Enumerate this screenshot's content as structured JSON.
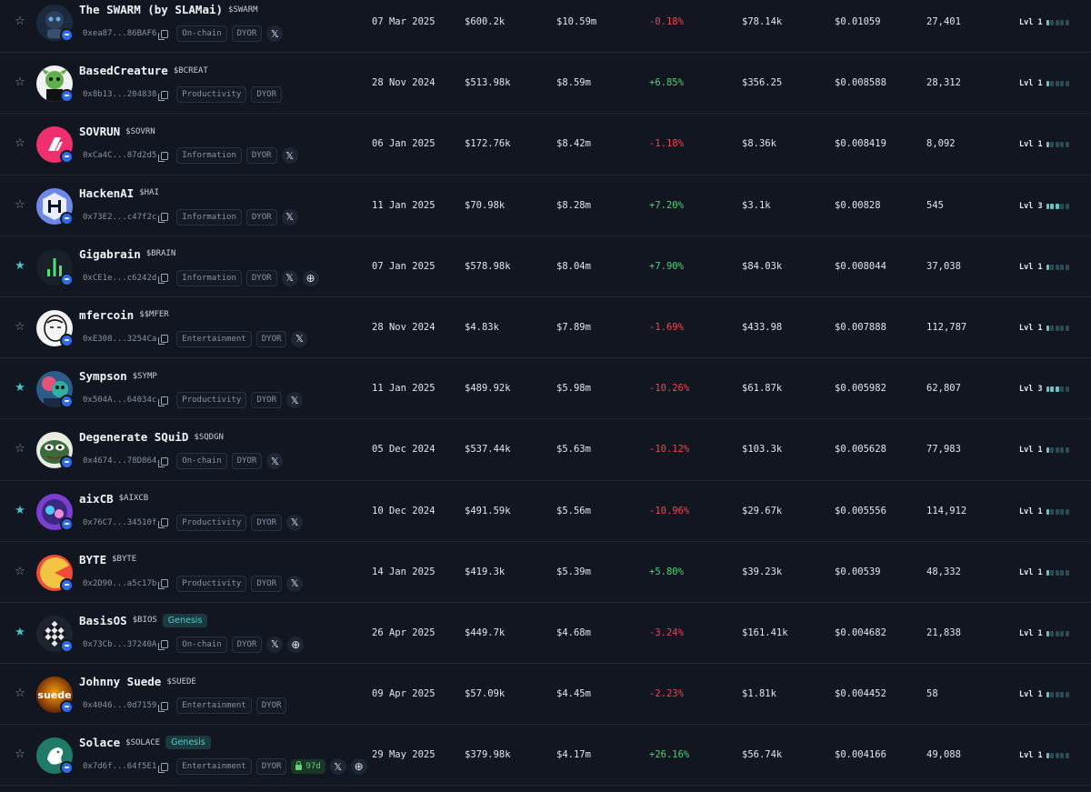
{
  "rows": [
    {
      "starred": false,
      "name": "The SWARM (by SLAMai)",
      "ticker": "$SWARM",
      "genesis": "",
      "address": "0xea87...86BAF6",
      "category": "On-chain",
      "dyor": "DYOR",
      "lock": "",
      "socials": [
        "x"
      ],
      "date": "07 Mar 2025",
      "liquidity": "$600.2k",
      "market_cap": "$10.59m",
      "change": "-0.18%",
      "change_dir": "neg",
      "volume": "$78.14k",
      "price": "$0.01059",
      "holders": "27,401",
      "level": "Lvl 1",
      "level_value": 1,
      "avatar_icon": "robot-avatar",
      "avatar_bg": "#1c2a3e",
      "avatar_fg": "#6aa6e8"
    },
    {
      "starred": false,
      "name": "BasedCreature",
      "ticker": "$BCREAT",
      "genesis": "",
      "address": "0x8b13...204838",
      "category": "Productivity",
      "dyor": "DYOR",
      "lock": "",
      "socials": [],
      "date": "28 Nov 2024",
      "liquidity": "$513.98k",
      "market_cap": "$8.59m",
      "change": "+6.85%",
      "change_dir": "pos",
      "volume": "$356.25",
      "price": "$0.008588",
      "holders": "28,312",
      "level": "Lvl 1",
      "level_value": 1,
      "avatar_icon": "creature-avatar",
      "avatar_bg": "#0b0d10",
      "avatar_fg": "#5fb04a"
    },
    {
      "starred": false,
      "name": "SOVRUN",
      "ticker": "$SOVRN",
      "genesis": "",
      "address": "0xCa4C...87d2d5",
      "category": "Information",
      "dyor": "DYOR",
      "lock": "",
      "socials": [
        "x"
      ],
      "date": "06 Jan 2025",
      "liquidity": "$172.76k",
      "market_cap": "$8.42m",
      "change": "-1.18%",
      "change_dir": "neg",
      "volume": "$8.36k",
      "price": "$0.008419",
      "holders": "8,092",
      "level": "Lvl 1",
      "level_value": 1,
      "avatar_icon": "sovrun-logo",
      "avatar_bg": "#f0306e",
      "avatar_fg": "#ffffff"
    },
    {
      "starred": false,
      "name": "HackenAI",
      "ticker": "$HAI",
      "genesis": "",
      "address": "0x73E2...c47f2c",
      "category": "Information",
      "dyor": "DYOR",
      "lock": "",
      "socials": [
        "x"
      ],
      "date": "11 Jan 2025",
      "liquidity": "$70.98k",
      "market_cap": "$8.28m",
      "change": "+7.20%",
      "change_dir": "pos",
      "volume": "$3.1k",
      "price": "$0.00828",
      "holders": "545",
      "level": "Lvl 3",
      "level_value": 3,
      "avatar_icon": "hacken-logo",
      "avatar_bg": "#6f88e8",
      "avatar_fg": "#0d1320"
    },
    {
      "starred": true,
      "name": "Gigabrain",
      "ticker": "$BRAIN",
      "genesis": "",
      "address": "0xCE1e...c6242d",
      "category": "Information",
      "dyor": "DYOR",
      "lock": "",
      "socials": [
        "x",
        "web"
      ],
      "date": "07 Jan 2025",
      "liquidity": "$578.98k",
      "market_cap": "$8.04m",
      "change": "+7.90%",
      "change_dir": "pos",
      "volume": "$84.03k",
      "price": "$0.008044",
      "holders": "37,038",
      "level": "Lvl 1",
      "level_value": 1,
      "avatar_icon": "gigabrain-logo",
      "avatar_bg": "#1a2028",
      "avatar_fg": "#4fe07a"
    },
    {
      "starred": false,
      "name": "mfercoin",
      "ticker": "$$MFER",
      "genesis": "",
      "address": "0xE308...3254Ca",
      "category": "Entertainment",
      "dyor": "DYOR",
      "lock": "",
      "socials": [
        "x"
      ],
      "date": "28 Nov 2024",
      "liquidity": "$4.83k",
      "market_cap": "$7.89m",
      "change": "-1.69%",
      "change_dir": "neg",
      "volume": "$433.98",
      "price": "$0.007888",
      "holders": "112,787",
      "level": "Lvl 1",
      "level_value": 1,
      "avatar_icon": "mfer-avatar",
      "avatar_bg": "#f4f4f4",
      "avatar_fg": "#111111"
    },
    {
      "starred": true,
      "name": "Sympson",
      "ticker": "$SYMP",
      "genesis": "",
      "address": "0x504A...64034c",
      "category": "Productivity",
      "dyor": "DYOR",
      "lock": "",
      "socials": [
        "x"
      ],
      "date": "11 Jan 2025",
      "liquidity": "$489.92k",
      "market_cap": "$5.98m",
      "change": "-10.26%",
      "change_dir": "neg",
      "volume": "$61.87k",
      "price": "$0.005982",
      "holders": "62,807",
      "level": "Lvl 3",
      "level_value": 3,
      "avatar_icon": "sympson-avatar",
      "avatar_bg": "#2c5d8a",
      "avatar_fg": "#e8527a"
    },
    {
      "starred": false,
      "name": "Degenerate SQuiD",
      "ticker": "$SQDGN",
      "genesis": "",
      "address": "0x4674...78D864",
      "category": "On-chain",
      "dyor": "DYOR",
      "lock": "",
      "socials": [
        "x"
      ],
      "date": "05 Dec 2024",
      "liquidity": "$537.44k",
      "market_cap": "$5.63m",
      "change": "-10.12%",
      "change_dir": "neg",
      "volume": "$103.3k",
      "price": "$0.005628",
      "holders": "77,983",
      "level": "Lvl 1",
      "level_value": 1,
      "avatar_icon": "pepe-avatar",
      "avatar_bg": "#3a6b3a",
      "avatar_fg": "#8fd06a"
    },
    {
      "starred": true,
      "name": "aixCB",
      "ticker": "$AIXCB",
      "genesis": "",
      "address": "0x76C7...34510f",
      "category": "Productivity",
      "dyor": "DYOR",
      "lock": "",
      "socials": [
        "x"
      ],
      "date": "10 Dec 2024",
      "liquidity": "$491.59k",
      "market_cap": "$5.56m",
      "change": "-10.96%",
      "change_dir": "neg",
      "volume": "$29.67k",
      "price": "$0.005556",
      "holders": "114,912",
      "level": "Lvl 1",
      "level_value": 1,
      "avatar_icon": "aixcb-avatar",
      "avatar_bg": "#7a3fd0",
      "avatar_fg": "#4fc7f0"
    },
    {
      "starred": false,
      "name": "BYTE",
      "ticker": "$BYTE",
      "genesis": "",
      "address": "0x2D90...a5c17b",
      "category": "Productivity",
      "dyor": "DYOR",
      "lock": "",
      "socials": [
        "x"
      ],
      "date": "14 Jan 2025",
      "liquidity": "$419.3k",
      "market_cap": "$5.39m",
      "change": "+5.80%",
      "change_dir": "pos",
      "volume": "$39.23k",
      "price": "$0.00539",
      "holders": "48,332",
      "level": "Lvl 1",
      "level_value": 1,
      "avatar_icon": "byte-logo",
      "avatar_bg": "#f04b3a",
      "avatar_fg": "#f4c542"
    },
    {
      "starred": true,
      "name": "BasisOS",
      "ticker": "$BIOS",
      "genesis": "Genesis",
      "address": "0x73Cb...37240A",
      "category": "On-chain",
      "dyor": "DYOR",
      "lock": "",
      "socials": [
        "x",
        "web"
      ],
      "date": "26 Apr 2025",
      "liquidity": "$449.7k",
      "market_cap": "$4.68m",
      "change": "-3.24%",
      "change_dir": "neg",
      "volume": "$161.41k",
      "price": "$0.004682",
      "holders": "21,838",
      "level": "Lvl 1",
      "level_value": 1,
      "avatar_icon": "basisos-logo",
      "avatar_bg": "#1d2430",
      "avatar_fg": "#e8e8e8"
    },
    {
      "starred": false,
      "name": "Johnny Suede",
      "ticker": "$SUEDE",
      "genesis": "",
      "address": "0x4046...0d7159",
      "category": "Entertainment",
      "dyor": "DYOR",
      "lock": "",
      "socials": [],
      "date": "09 Apr 2025",
      "liquidity": "$57.09k",
      "market_cap": "$4.45m",
      "change": "-2.23%",
      "change_dir": "neg",
      "volume": "$1.81k",
      "price": "$0.004452",
      "holders": "58",
      "level": "Lvl 1",
      "level_value": 1,
      "avatar_icon": "suede-logo",
      "avatar_bg": "#c2410c",
      "avatar_fg": "#ffffff",
      "avatar_text": "suede"
    },
    {
      "starred": false,
      "name": "Solace",
      "ticker": "$SOLACE",
      "genesis": "Genesis",
      "address": "0x7d6f...64f5E1",
      "category": "Entertainment",
      "dyor": "DYOR",
      "lock": "97d",
      "socials": [
        "x",
        "web"
      ],
      "date": "29 May 2025",
      "liquidity": "$379.98k",
      "market_cap": "$4.17m",
      "change": "+26.16%",
      "change_dir": "pos",
      "volume": "$56.74k",
      "price": "$0.004166",
      "holders": "49,088",
      "level": "Lvl 1",
      "level_value": 1,
      "avatar_icon": "solace-logo",
      "avatar_bg": "#1f7a66",
      "avatar_fg": "#ffffff"
    }
  ],
  "icons": {
    "star": "star-icon",
    "copy": "copy-icon",
    "x": "x-icon",
    "web": "globe-icon",
    "lock": "lock-icon",
    "verified": "verified-badge-icon"
  },
  "colors": {
    "background": "#111620",
    "positive": "#4fd17a",
    "negative": "#f0474e",
    "accent": "#5cc8c9"
  }
}
